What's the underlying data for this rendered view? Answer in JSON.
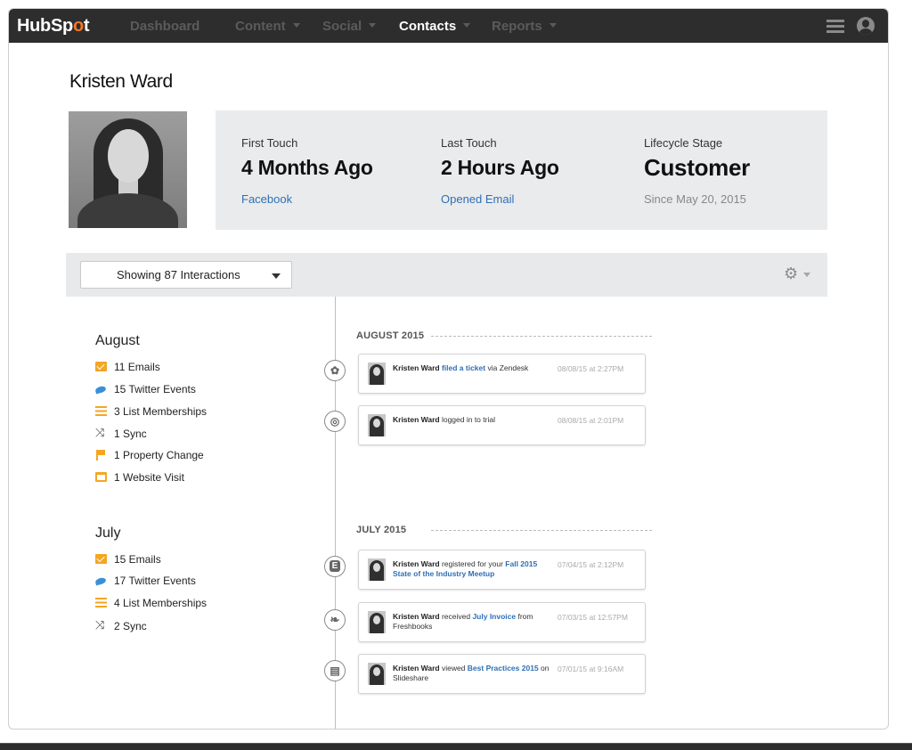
{
  "nav": {
    "logo_prefix": "HubSp",
    "logo_o": "o",
    "logo_suffix": "t",
    "items": [
      {
        "label": "Dashboard",
        "has_caret": false
      },
      {
        "label": "Content",
        "has_caret": true
      },
      {
        "label": "Social",
        "has_caret": true
      },
      {
        "label": "Contacts",
        "has_caret": true,
        "active": true
      },
      {
        "label": "Reports",
        "has_caret": true
      }
    ]
  },
  "contact": {
    "name": "Kristen Ward"
  },
  "stats": {
    "first_touch": {
      "label": "First Touch",
      "value": "4 Months Ago",
      "sub": "Facebook"
    },
    "last_touch": {
      "label": "Last Touch",
      "value": "2 Hours Ago",
      "sub": "Opened Email"
    },
    "lifecycle": {
      "label": "Lifecycle Stage",
      "value": "Customer",
      "sub": "Since May 20, 2015"
    }
  },
  "toolbar": {
    "filter_label": "Showing 87 Interactions"
  },
  "summary": {
    "months": [
      {
        "name": "August",
        "items": [
          {
            "icon": "email-icon",
            "text": "11 Emails"
          },
          {
            "icon": "twitter-icon",
            "text": "15 Twitter Events"
          },
          {
            "icon": "list-icon",
            "text": "3 List Memberships"
          },
          {
            "icon": "sync-icon",
            "text": "1 Sync"
          },
          {
            "icon": "flag-icon",
            "text": "1 Property Change"
          },
          {
            "icon": "website-icon",
            "text": "1 Website Visit"
          }
        ]
      },
      {
        "name": "July",
        "items": [
          {
            "icon": "email-icon",
            "text": "15 Emails"
          },
          {
            "icon": "twitter-icon",
            "text": "17 Twitter Events"
          },
          {
            "icon": "list-icon",
            "text": "4 List Memberships"
          },
          {
            "icon": "sync-icon",
            "text": "2 Sync"
          }
        ]
      }
    ]
  },
  "timeline": {
    "sections": [
      {
        "heading": "AUGUST 2015",
        "events": [
          {
            "icon": "zendesk-icon",
            "who": "Kristen Ward",
            "pre": " ",
            "link": "filed a ticket",
            "post": " via Zendesk",
            "time": "08/08/15 at 2:27PM"
          },
          {
            "icon": "login-icon",
            "who": "Kristen Ward",
            "pre": " logged in to trial",
            "link": "",
            "post": "",
            "time": "08/08/15 at 2:01PM"
          }
        ]
      },
      {
        "heading": "JULY 2015",
        "events": [
          {
            "icon": "event-icon",
            "who": "Kristen Ward",
            "pre": " registered for your ",
            "link": "Fall 2015 State of the Industry Meetup",
            "post": "",
            "time": "07/04/15 at 2:12PM"
          },
          {
            "icon": "freshbooks-icon",
            "who": "Kristen Ward",
            "pre": " received ",
            "link": "July Invoice",
            "post": " from Freshbooks",
            "time": "07/03/15 at 12:57PM"
          },
          {
            "icon": "slideshare-icon",
            "who": "Kristen Ward",
            "pre": " viewed ",
            "link": "Best Practices 2015",
            "post": " on Slideshare",
            "time": "07/01/15 at 9:16AM"
          }
        ]
      }
    ]
  },
  "colors": {
    "nav_bg": "#2d2d2d",
    "accent_orange": "#f57722",
    "link_blue": "#2f6fb5",
    "panel_grey": "#eaebec"
  }
}
